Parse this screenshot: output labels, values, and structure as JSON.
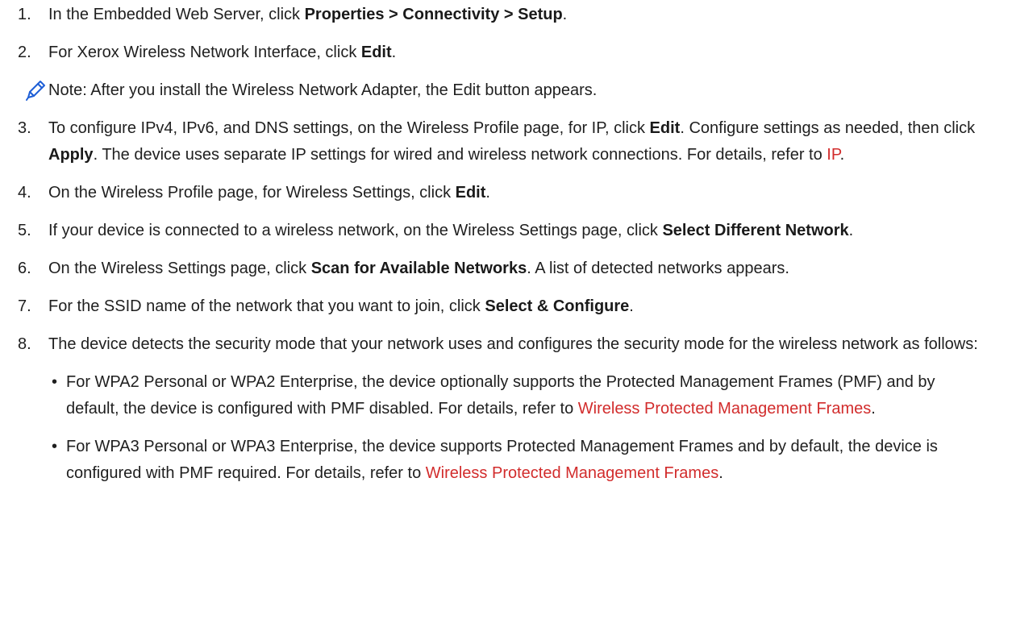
{
  "steps": [
    {
      "num": "1.",
      "t1": "In the Embedded Web Server, click ",
      "b1": "Properties > Connectivity > Setup",
      "t2": "."
    },
    {
      "num": "2.",
      "t1": "For Xerox Wireless Network Interface, click ",
      "b1": "Edit",
      "t2": "."
    },
    {
      "num": "3.",
      "t1": "To configure IPv4, IPv6, and DNS settings, on the Wireless Profile page, for IP, click ",
      "b1": "Edit",
      "t2": ". Configure settings as needed, then click ",
      "b2": "Apply",
      "t3": ". The device uses separate IP settings for wired and wireless network connections. For details, refer to ",
      "link": "IP",
      "t4": "."
    },
    {
      "num": "4.",
      "t1": "On the Wireless Profile page, for Wireless Settings, click ",
      "b1": "Edit",
      "t2": "."
    },
    {
      "num": "5.",
      "t1": "If your device is connected to a wireless network, on the Wireless Settings page, click ",
      "b1": "Select Different Network",
      "t2": "."
    },
    {
      "num": "6.",
      "t1": "On the Wireless Settings page, click ",
      "b1": "Scan for Available Networks",
      "t2": ". A list of detected networks appears."
    },
    {
      "num": "7.",
      "t1": "For the SSID name of the network that you want to join, click ",
      "b1": "Select & Configure",
      "t2": "."
    },
    {
      "num": "8.",
      "t1": "The device detects the security mode that your network uses and configures the security mode for the wireless network as follows:"
    }
  ],
  "note": {
    "icon": "pencil-icon",
    "text": "Note: After you install the Wireless Network Adapter, the Edit button appears."
  },
  "bullets": [
    {
      "marker": "•",
      "t1": "For WPA2 Personal or WPA2 Enterprise, the device optionally supports the Protected Management Frames (PMF) and by default, the device is configured with PMF disabled. For details, refer to ",
      "link": "Wireless Protected Management Frames",
      "t2": "."
    },
    {
      "marker": "•",
      "t1": "For WPA3 Personal or WPA3 Enterprise, the device supports Protected Management Frames and by default, the device is configured with PMF required. For details, refer to ",
      "link": "Wireless Protected Management Frames",
      "t2": "."
    }
  ],
  "colors": {
    "text": "#1f1f1f",
    "link": "#d22c2c",
    "icon": "#1e5fd6"
  }
}
